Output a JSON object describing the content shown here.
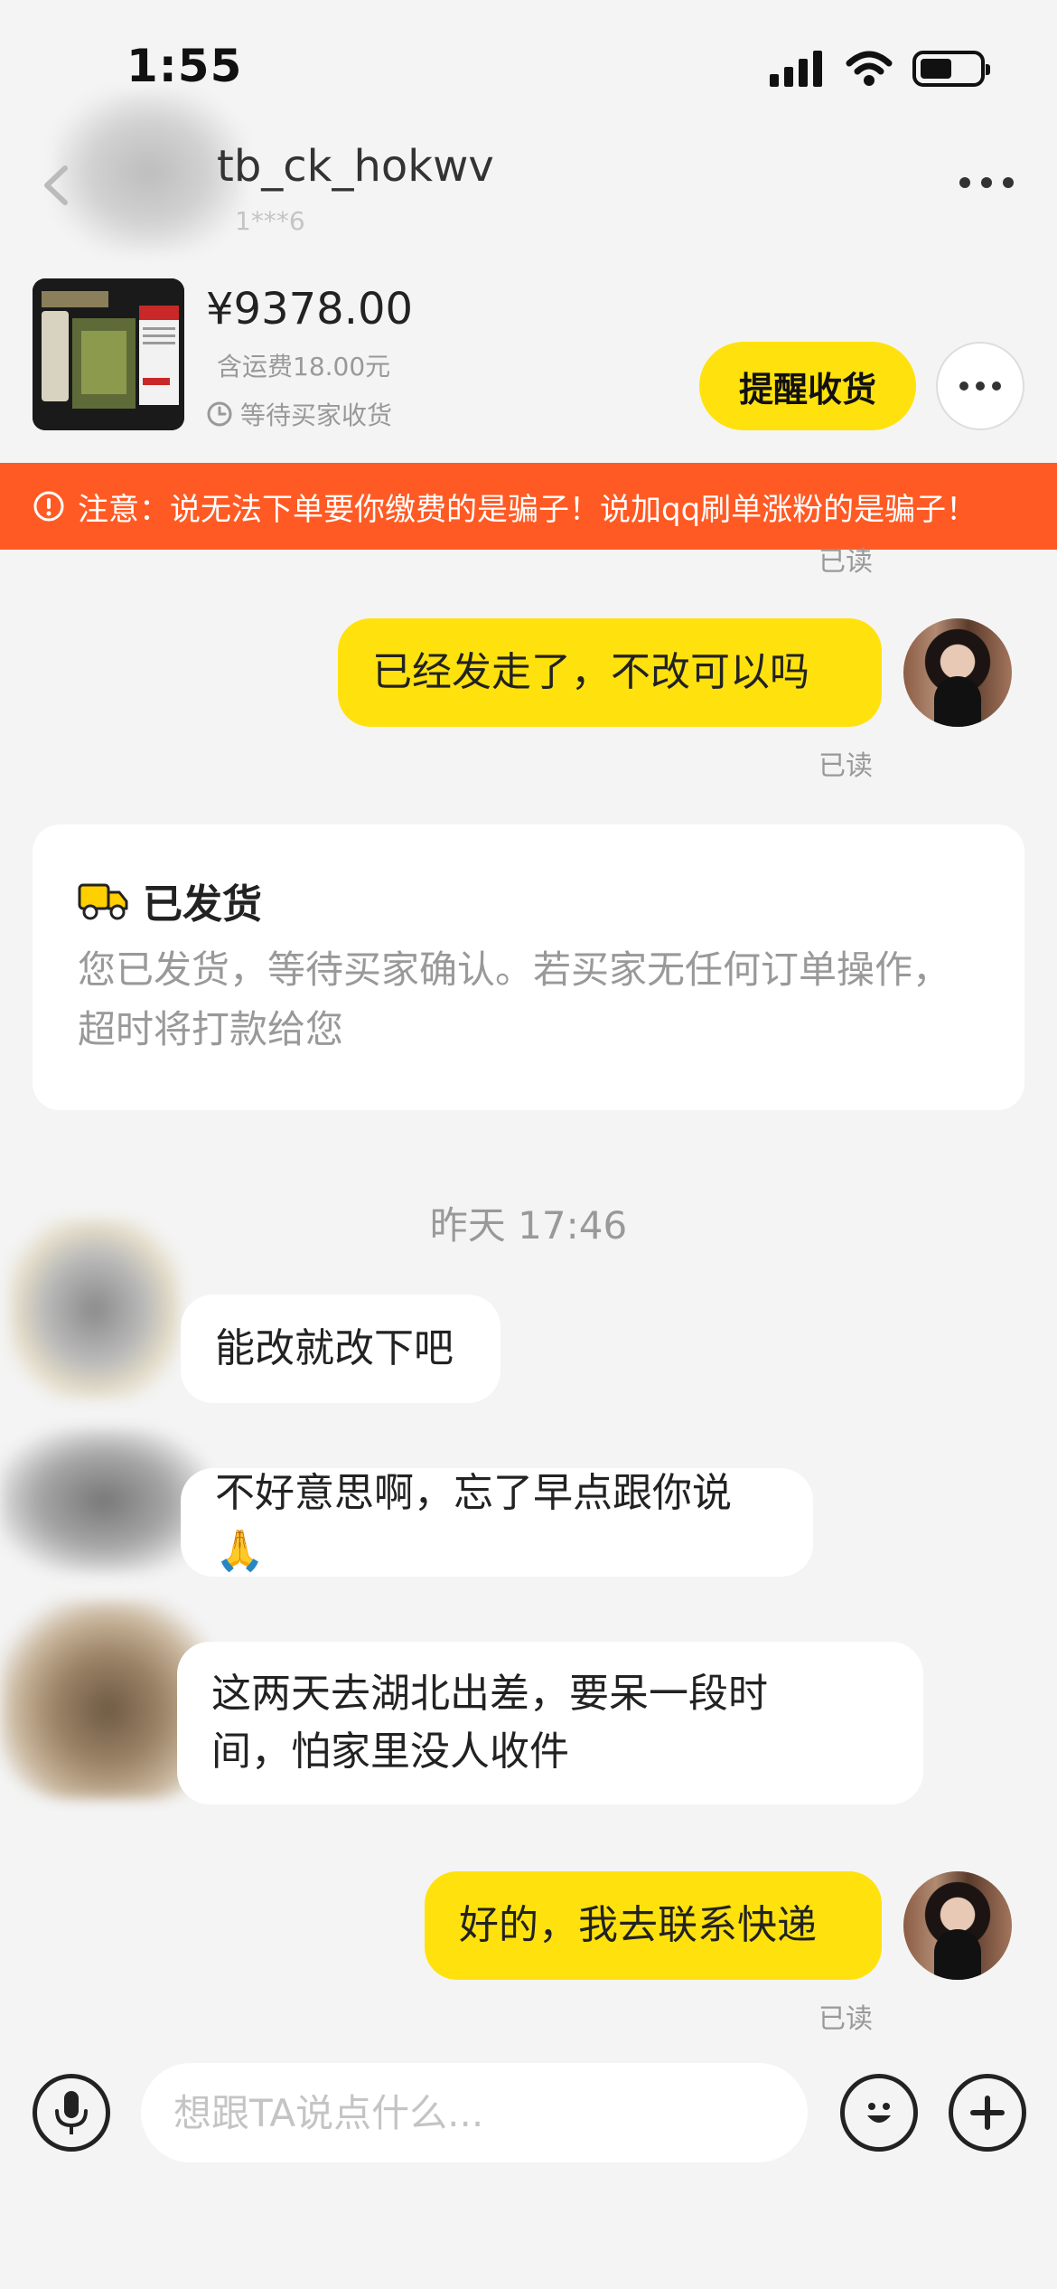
{
  "status_bar": {
    "time": "1:55"
  },
  "header": {
    "contact_name": "tb_ck_hokwv",
    "contact_sub": "1***6"
  },
  "product": {
    "price": "¥9378.00",
    "shipping": "含运费18.00元",
    "status": "等待买家收货",
    "remind_label": "提醒收货"
  },
  "warning": {
    "text": "注意：说无法下单要你缴费的是骗子！说加qq刷单涨粉的是骗子！"
  },
  "messages": {
    "read_top_partial": "已读",
    "msg1": {
      "text": "已经发走了，不改可以吗",
      "read": "已读"
    },
    "card": {
      "title": "已发货",
      "body": "您已发货，等待买家确认。若买家无任何订单操作，超时将打款给您"
    },
    "time_label": "昨天 17:46",
    "msg2": {
      "text": "能改就改下吧"
    },
    "msg3": {
      "text": "不好意思啊，忘了早点跟你说🙏"
    },
    "msg4": {
      "text": "这两天去湖北出差，要呆一段时间，怕家里没人收件"
    },
    "msg5": {
      "text": "好的，我去联系快递",
      "read": "已读"
    }
  },
  "input": {
    "placeholder": "想跟TA说点什么..."
  },
  "colors": {
    "accent": "#ffe20d",
    "warning": "#ff5a24",
    "background": "#f4f4f4"
  }
}
